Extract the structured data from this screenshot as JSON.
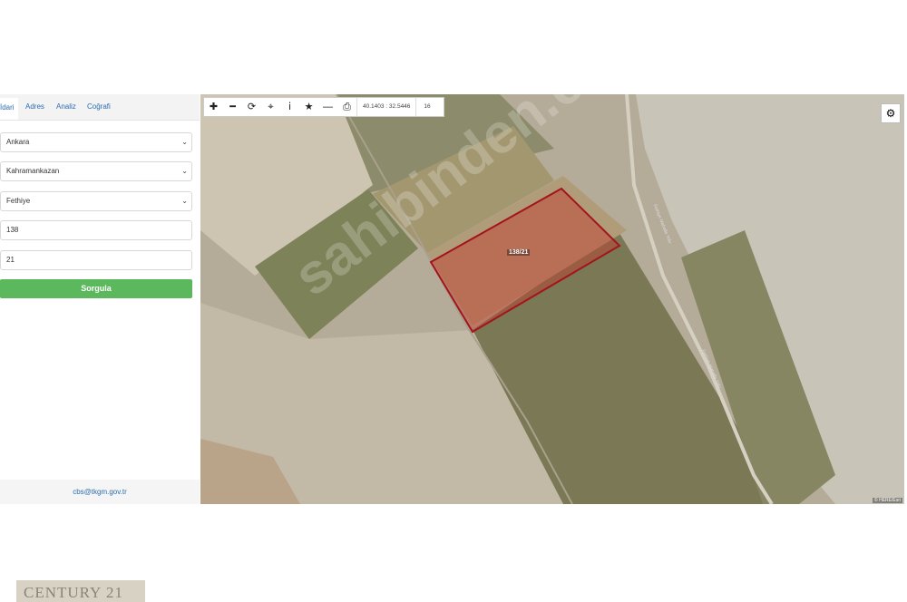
{
  "panel": {
    "tabs": [
      "İdari",
      "Adres",
      "Analiz",
      "Coğrafi"
    ],
    "province": "Ankara",
    "district": "Kahramankazan",
    "neighborhood": "Fethiye",
    "block": "138",
    "parcel": "21",
    "query_button": "Sorgula",
    "email": "cbs@tkgm.gov.tr"
  },
  "map": {
    "coordinates": "40.1403 : 32.5446",
    "zoom": "16",
    "parcel_label": "138/21",
    "watermark": "sahibinden.com",
    "attribution": "© HERE/Esri",
    "road_labels": [
      "Fethiye Mahalle Yolu",
      "Fethiye Mahalle Yolu"
    ]
  },
  "logo": "CENTURY 21",
  "colors": {
    "button": "#5cb85c",
    "parcel_fill": "#c0392b",
    "link": "#2a6db0"
  },
  "icons": [
    "plus-icon",
    "minus-icon",
    "refresh-icon",
    "locate-icon",
    "info-icon",
    "star-icon",
    "measure-icon",
    "print-icon",
    "gear-icon"
  ]
}
